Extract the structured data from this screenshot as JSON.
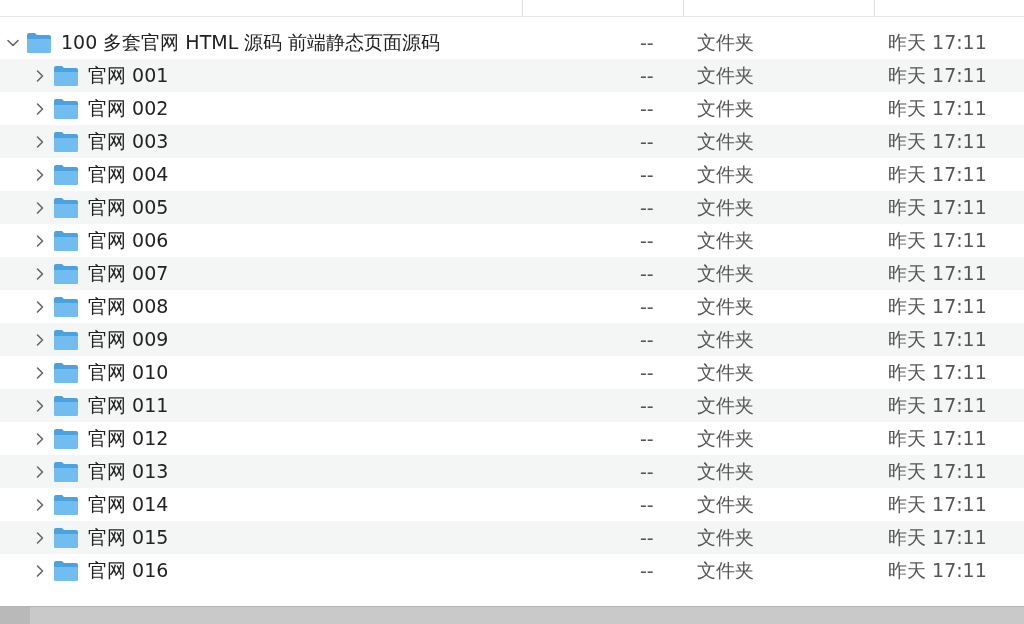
{
  "folder": {
    "name": "100 多套官网 HTML 源码 前端静态页面源码",
    "size": "--",
    "kind": "文件夹",
    "date": "昨天 17:11",
    "expanded": true,
    "children": [
      {
        "name": "官网 001",
        "size": "--",
        "kind": "文件夹",
        "date": "昨天 17:11",
        "expanded": false
      },
      {
        "name": "官网 002",
        "size": "--",
        "kind": "文件夹",
        "date": "昨天 17:11",
        "expanded": false
      },
      {
        "name": "官网 003",
        "size": "--",
        "kind": "文件夹",
        "date": "昨天 17:11",
        "expanded": false
      },
      {
        "name": "官网 004",
        "size": "--",
        "kind": "文件夹",
        "date": "昨天 17:11",
        "expanded": false
      },
      {
        "name": "官网 005",
        "size": "--",
        "kind": "文件夹",
        "date": "昨天 17:11",
        "expanded": false
      },
      {
        "name": "官网 006",
        "size": "--",
        "kind": "文件夹",
        "date": "昨天 17:11",
        "expanded": false
      },
      {
        "name": "官网 007",
        "size": "--",
        "kind": "文件夹",
        "date": "昨天 17:11",
        "expanded": false
      },
      {
        "name": "官网 008",
        "size": "--",
        "kind": "文件夹",
        "date": "昨天 17:11",
        "expanded": false
      },
      {
        "name": "官网 009",
        "size": "--",
        "kind": "文件夹",
        "date": "昨天 17:11",
        "expanded": false
      },
      {
        "name": "官网 010",
        "size": "--",
        "kind": "文件夹",
        "date": "昨天 17:11",
        "expanded": false
      },
      {
        "name": "官网 011",
        "size": "--",
        "kind": "文件夹",
        "date": "昨天 17:11",
        "expanded": false
      },
      {
        "name": "官网 012",
        "size": "--",
        "kind": "文件夹",
        "date": "昨天 17:11",
        "expanded": false
      },
      {
        "name": "官网 013",
        "size": "--",
        "kind": "文件夹",
        "date": "昨天 17:11",
        "expanded": false
      },
      {
        "name": "官网 014",
        "size": "--",
        "kind": "文件夹",
        "date": "昨天 17:11",
        "expanded": false
      },
      {
        "name": "官网 015",
        "size": "--",
        "kind": "文件夹",
        "date": "昨天 17:11",
        "expanded": false
      },
      {
        "name": "官网 016",
        "size": "--",
        "kind": "文件夹",
        "date": "昨天 17:11",
        "expanded": false
      }
    ]
  }
}
